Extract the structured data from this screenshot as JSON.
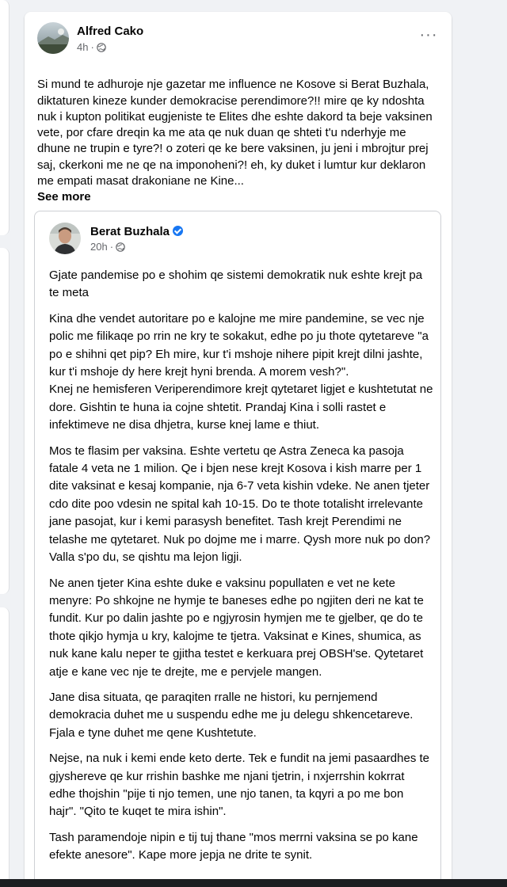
{
  "post": {
    "author": "Alfred Cako",
    "time": "4h",
    "separator": "·",
    "more_label": "···",
    "text": "Si mund te adhuroje nje gazetar me influence ne Kosove si Berat Buzhala, diktaturen kineze kunder demokracise perendimore?!! mire qe ky ndoshta nuk i kupton politikat eugjeniste te Elites dhe eshte dakord ta beje vaksinen vete, por cfare dreqin ka me ata qe nuk duan qe shteti t'u nderhyje me dhune ne trupin e tyre?! o zoteri qe ke bere vaksinen, ju jeni i mbrojtur prej saj, ckerkoni me ne qe na imponoheni?! eh, ky duket i lumtur kur deklaron me empati masat drakoniane ne Kine...",
    "see_more": "See more"
  },
  "shared": {
    "author": "Berat Buzhala",
    "time": "20h",
    "separator": "·",
    "paragraphs": [
      "Gjate pandemise po e shohim qe sistemi demokratik nuk eshte krejt pa te meta",
      "Kina dhe vendet autoritare po e kalojne me mire pandemine, se vec nje polic me filikaqe po rrin ne kry te sokakut, edhe po ju thote qytetareve \"a po e shihni qet pip? Eh mire, kur t'i mshoje nihere pipit krejt dilni jashte, kur t'i mshoje dy here krejt hyni brenda. A morem vesh?\".\nKnej ne hemisferen Veriperendimore krejt qytetaret ligjet e kushtetutat ne dore. Gishtin te huna ia cojne shtetit. Prandaj Kina i solli rastet e infektimeve ne disa dhjetra, kurse knej lame e thiut.",
      "Mos te flasim per vaksina. Eshte vertetu qe Astra Zeneca ka pasoja fatale 4 veta ne 1 milion. Qe i bjen nese krejt Kosova i kish marre per 1 dite vaksinat e kesaj kompanie, nja 6-7 veta kishin vdeke. Ne anen tjeter cdo dite poo vdesin ne spital kah 10-15. Do te thote totalisht irrelevante jane pasojat, kur i kemi parasysh benefitet. Tash krejt Perendimi ne telashe me qytetaret. Nuk po dojme me i marre. Qysh more nuk po don? Valla s'po du, se qishtu ma lejon ligji.",
      "Ne anen tjeter Kina eshte duke e vaksinu popullaten e vet ne kete menyre: Po shkojne ne hymje te baneses edhe po ngjiten deri ne kat te fundit. Kur po dalin jashte po e ngjyrosin hymjen me te gjelber, qe do te thote qikjo hymja u kry, kalojme te tjetra. Vaksinat e Kines, shumica, as nuk kane kalu neper te gjitha testet e kerkuara prej OBSH'se. Qytetaret atje e kane vec nje te drejte, me e pervjele mangen.",
      "Jane disa situata, qe paraqiten rralle ne histori, ku pernjemend demokracia duhet me u suspendu edhe me ju delegu shkencetareve. Fjala e tyne duhet me qene Kushtetute.",
      "Nejse, na nuk i kemi ende keto derte. Tek e fundit na jemi pasaardhes te gjyshereve qe kur rrishin bashke me njani tjetrin, i nxjerrshin kokrrat edhe thojshin \"pije ti njo temen, une njo tanen, ta kqyri a po me bon hajr\". \"Qito te kuqet te mira ishin\".",
      "Tash paramendoje nipin e tij tuj thane \"mos merrni vaksina se po kane efekte anesore\". Kape more jepja ne drite te synit."
    ]
  },
  "colors": {
    "background": "#f0f2f5",
    "card": "#ffffff",
    "text": "#050505",
    "secondary_text": "#65676b",
    "verified": "#1877f2"
  },
  "icons": [
    "globe-icon",
    "verified-badge-icon",
    "more-options-icon"
  ]
}
